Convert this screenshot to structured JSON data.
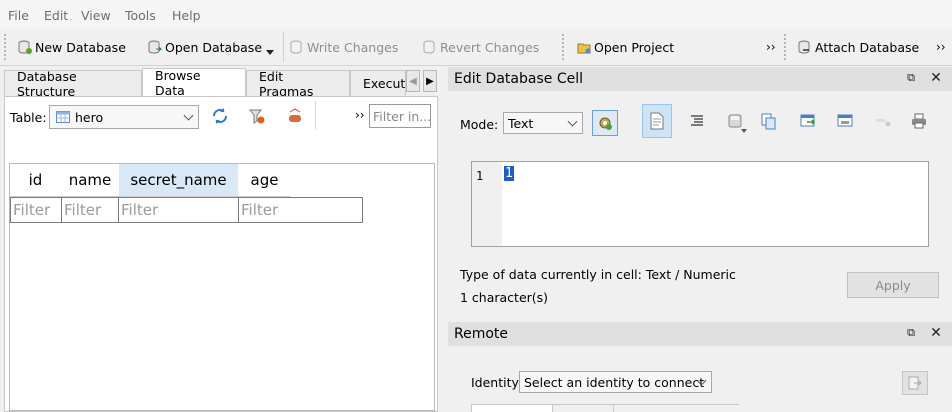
{
  "menu": [
    "File",
    "Edit",
    "View",
    "Tools",
    "Help"
  ],
  "toolbar": {
    "new_database": "New Database",
    "open_database": "Open Database",
    "write_changes": "Write Changes",
    "revert_changes": "Revert Changes",
    "open_project": "Open Project",
    "attach_database": "Attach Database",
    "overflow": "››"
  },
  "tabs": [
    "Database Structure",
    "Browse Data",
    "Edit Pragmas",
    "Execut"
  ],
  "browse": {
    "table_label": "Table:",
    "table_value": "hero",
    "overflow": "››",
    "filter_placeholder": "Filter in...",
    "columns": [
      "id",
      "name",
      "secret_name",
      "age"
    ],
    "filter_text": "Filter"
  },
  "edit_cell": {
    "title": "Edit Database Cell",
    "mode_label": "Mode:",
    "mode_value": "Text",
    "line_number": "1",
    "cell_value": "1",
    "type_info": "Type of data currently in cell: Text / Numeric",
    "char_info": "1 character(s)",
    "apply": "Apply"
  },
  "remote": {
    "title": "Remote",
    "identity_label": "Identity",
    "identity_value": "Select an identity to connect"
  },
  "colors": {
    "selection": "#1c5fc4",
    "header_selected": "#d9e8f7",
    "pressed": "#cde3f7"
  }
}
